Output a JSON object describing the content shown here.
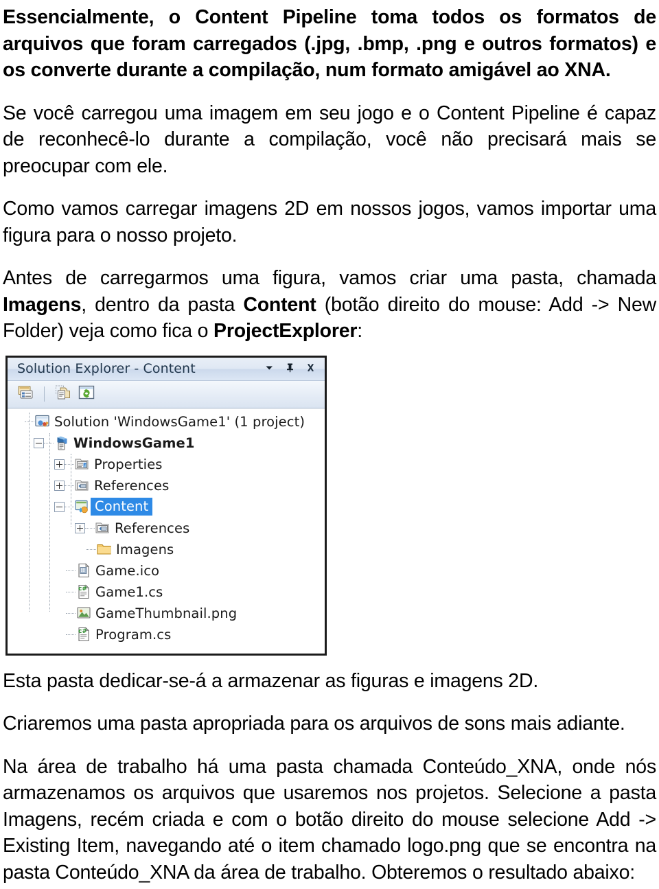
{
  "document": {
    "paragraphs": {
      "intro": "Essencialmente, o Content Pipeline toma todos os formatos de arquivos que foram carregados (.jpg, .bmp, .png e outros formatos) e os converte durante a compilação, num formato amigável ao XNA.",
      "recognize": "Se você carregou uma imagem em seu jogo e o Content Pipeline é capaz de reconhecê-lo   durante a compilação, você não precisará mais se preocupar com ele.",
      "import": "Como vamos carregar imagens 2D em nossos jogos, vamos importar uma figura para o nosso projeto.",
      "folder_line1": "Antes de carregarmos uma figura, vamos criar uma pasta, chamada ",
      "folder_bold1": "Imagens",
      "folder_line2": ", dentro da pasta ",
      "folder_bold2": "Content",
      "folder_line3": " (botão direito do mouse: Add -> New Folder) veja como fica o ",
      "folder_bold3": "ProjectExplorer",
      "folder_line4": ":",
      "after1": "Esta pasta dedicar-se-á a armazenar as figuras e imagens 2D.",
      "after2": "Criaremos uma pasta apropriada para os arquivos de sons mais adiante.",
      "after3": "Na área de trabalho há uma pasta chamada Conteúdo_XNA, onde nós armazenamos os arquivos que usaremos nos projetos. Selecione a pasta Imagens, recém criada e com o botão direito do mouse selecione Add -> Existing Item, navegando até o item chamado logo.png que se encontra na pasta Conteúdo_XNA da área de trabalho. Obteremos o resultado abaixo:"
    }
  },
  "solution_explorer": {
    "title": "Solution Explorer - Content",
    "titlebar_buttons": [
      {
        "name": "window-menu-dropdown",
        "glyph": "chevron-down-icon"
      },
      {
        "name": "auto-hide-pin",
        "glyph": "pin-icon"
      },
      {
        "name": "close-panel",
        "glyph": "close-icon"
      }
    ],
    "toolbar_buttons": [
      {
        "name": "properties-window-button",
        "icon": "properties-window-icon"
      },
      {
        "name": "show-all-files-button",
        "icon": "show-all-files-icon"
      },
      {
        "name": "refresh-button",
        "icon": "refresh-icon"
      }
    ],
    "selection_color": "#2e8ae6",
    "tree": [
      {
        "label": "Solution 'WindowsGame1' (1 project)",
        "indent": 0,
        "expander": "none",
        "icon": "solution-icon",
        "bold": false,
        "selected": false
      },
      {
        "label": "WindowsGame1",
        "indent": 1,
        "expander": "minus",
        "icon": "csharp-project-icon",
        "bold": true,
        "selected": false
      },
      {
        "label": "Properties",
        "indent": 2,
        "expander": "plus",
        "icon": "properties-folder-icon",
        "bold": false,
        "selected": false
      },
      {
        "label": "References",
        "indent": 2,
        "expander": "plus",
        "icon": "references-folder-icon",
        "bold": false,
        "selected": false
      },
      {
        "label": "Content",
        "indent": 2,
        "expander": "minus",
        "icon": "content-project-icon",
        "bold": false,
        "selected": true
      },
      {
        "label": "References",
        "indent": 3,
        "expander": "plus",
        "icon": "references-folder-icon",
        "bold": false,
        "selected": false
      },
      {
        "label": "Imagens",
        "indent": 3,
        "expander": "none",
        "icon": "folder-icon",
        "bold": false,
        "selected": false
      },
      {
        "label": "Game.ico",
        "indent": 2,
        "expander": "none",
        "icon": "ico-file-icon",
        "bold": false,
        "selected": false
      },
      {
        "label": "Game1.cs",
        "indent": 2,
        "expander": "none",
        "icon": "csharp-file-icon",
        "bold": false,
        "selected": false
      },
      {
        "label": "GameThumbnail.png",
        "indent": 2,
        "expander": "none",
        "icon": "image-file-icon",
        "bold": false,
        "selected": false
      },
      {
        "label": "Program.cs",
        "indent": 2,
        "expander": "none",
        "icon": "csharp-file-icon",
        "bold": false,
        "selected": false
      }
    ]
  }
}
